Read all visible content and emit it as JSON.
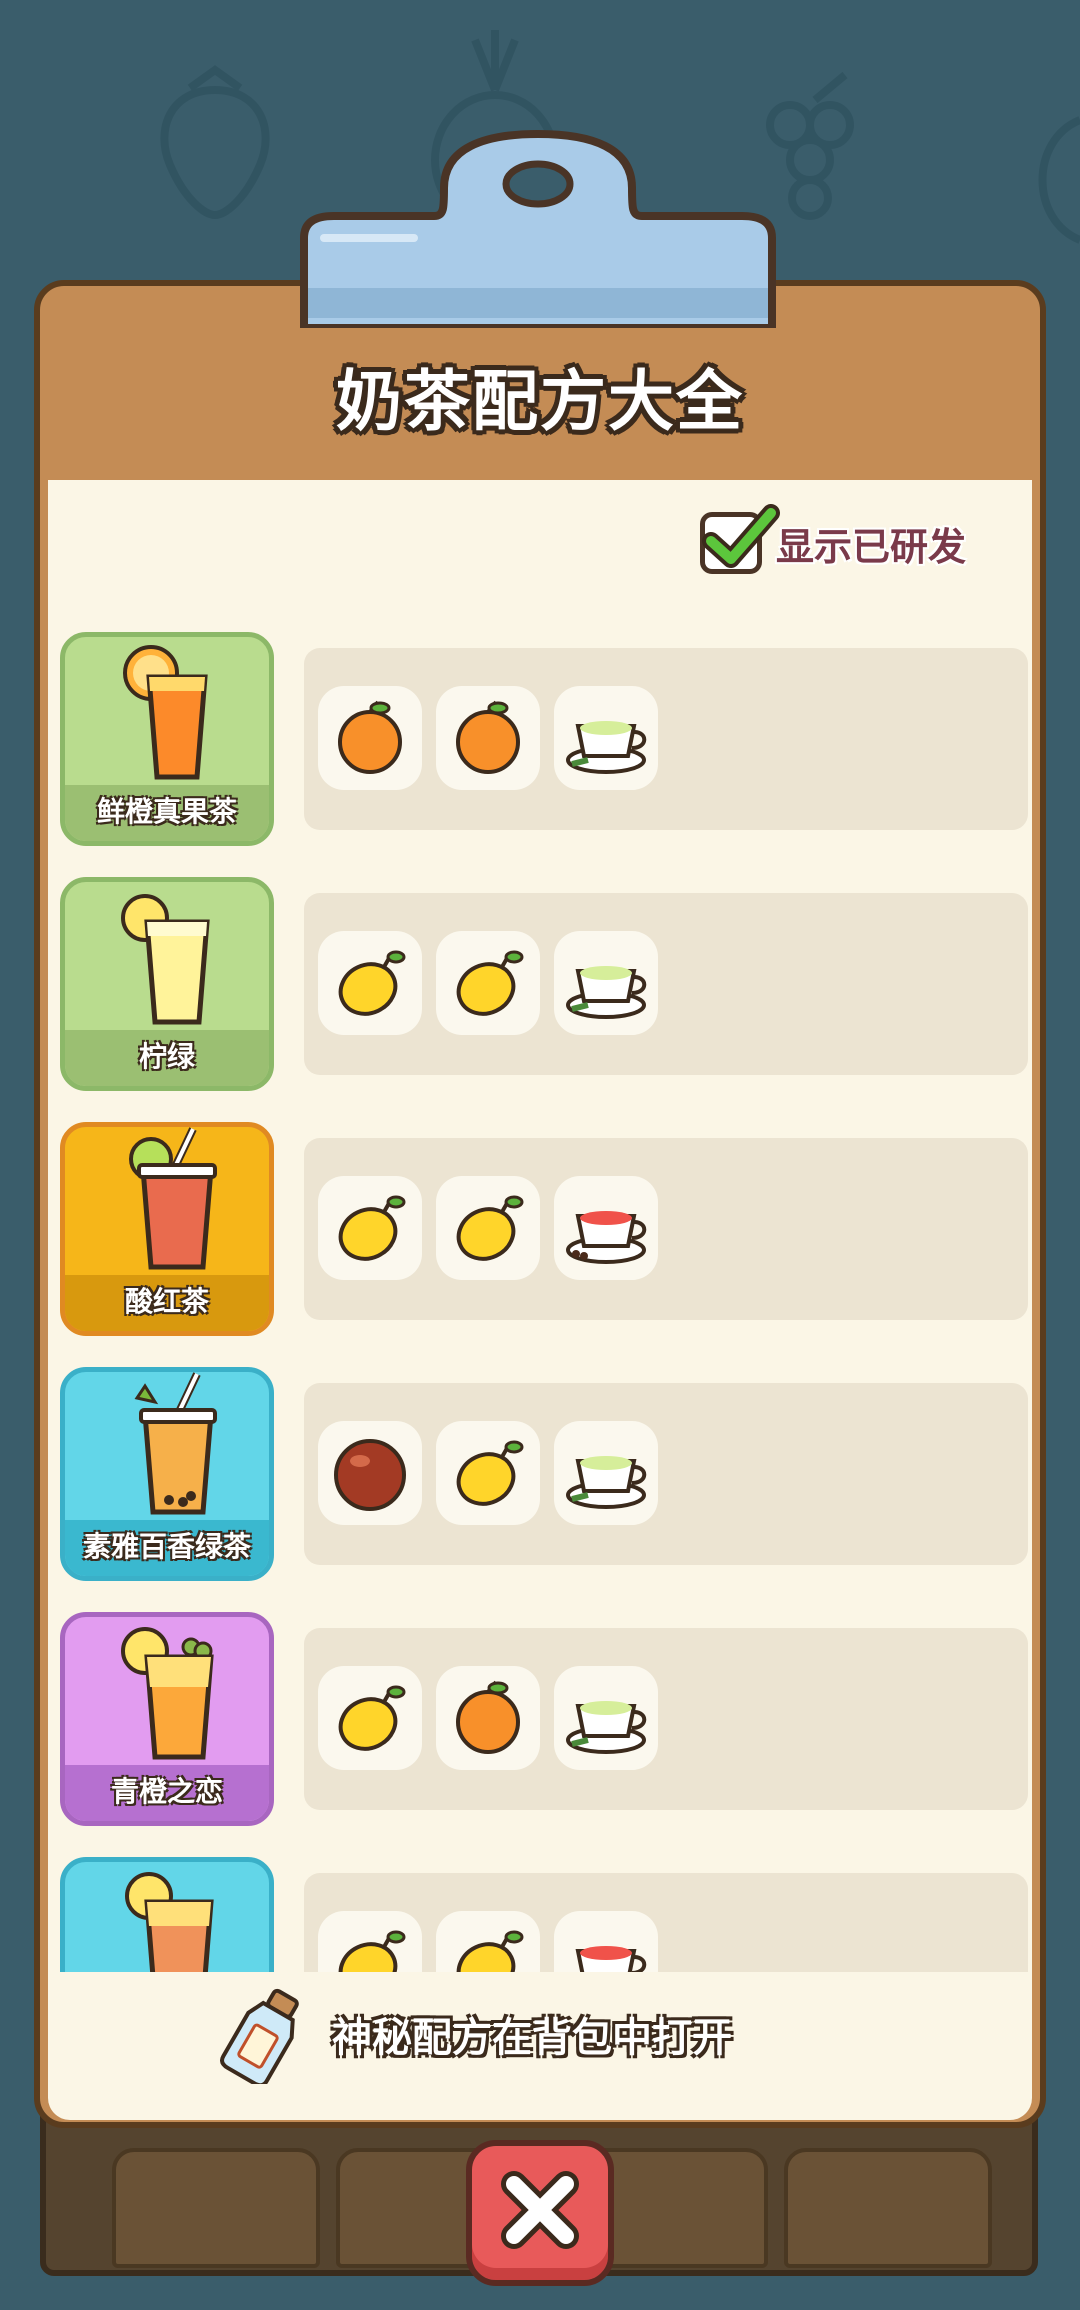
{
  "title": "奶茶配方大全",
  "show_researched": {
    "label": "显示已研发",
    "checked": true
  },
  "recipes": [
    {
      "name": "鲜橙真果茶",
      "theme": "green",
      "ingredients": [
        "orange-icon",
        "orange-icon",
        "green-tea-icon"
      ]
    },
    {
      "name": "柠绿",
      "theme": "green",
      "ingredients": [
        "lemon-icon",
        "lemon-icon",
        "green-tea-icon"
      ]
    },
    {
      "name": "酸红茶",
      "theme": "amber",
      "ingredients": [
        "lemon-icon",
        "lemon-icon",
        "red-tea-icon"
      ]
    },
    {
      "name": "素雅百香绿茶",
      "theme": "cyan",
      "ingredients": [
        "passion-fruit-icon",
        "lemon-icon",
        "green-tea-icon"
      ]
    },
    {
      "name": "青橙之恋",
      "theme": "purple",
      "ingredients": [
        "lemon-icon",
        "orange-icon",
        "green-tea-icon"
      ]
    },
    {
      "name": "",
      "theme": "cyan",
      "ingredients": [
        "lemon-icon",
        "lemon-icon",
        "red-tea-icon"
      ]
    }
  ],
  "hint": {
    "text": "神秘配方在背包中打开",
    "icon": "message-bottle-icon"
  },
  "close": {
    "icon": "close-icon"
  },
  "colors": {
    "board": "#c48c55",
    "paper": "#fbf6e6",
    "green": "#b9dc8e",
    "amber": "#f6b619",
    "cyan": "#62d6e8",
    "purple": "#d79ae8",
    "close": "#e85a5a"
  }
}
